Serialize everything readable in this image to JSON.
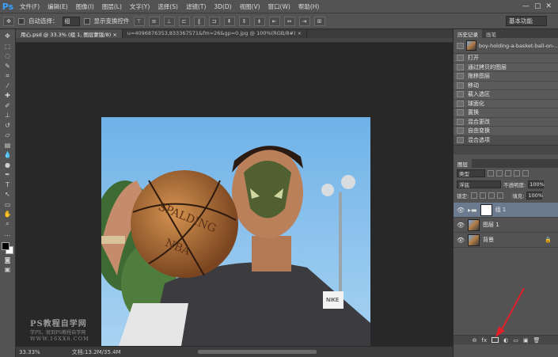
{
  "app": {
    "logo": "Ps"
  },
  "menu": [
    "文件(F)",
    "编辑(E)",
    "图像(I)",
    "图层(L)",
    "文字(Y)",
    "选择(S)",
    "滤镜(T)",
    "3D(D)",
    "视图(V)",
    "窗口(W)",
    "帮助(H)"
  ],
  "window_controls": [
    "—",
    "▢",
    "✕"
  ],
  "options": {
    "auto_select_label": "自动选择：",
    "auto_select_value": "组",
    "show_transform_label": "显示变换控件",
    "workspace": "基本功能"
  },
  "tabs": [
    {
      "label": "用心.psd @ 33.3% (组 1, 图层蒙版/8) × ",
      "active": true
    },
    {
      "label": "u=4096876353,833367571&fm=26&gp=0.jpg @ 100%(RGB/8#) ×",
      "active": false
    }
  ],
  "watermark": {
    "title": "PS教程自学网",
    "sub": "学PS，就到PS教程自学网",
    "url": "WWW.16XX8.COM"
  },
  "status": {
    "zoom": "33.33%",
    "doc": "文档:13.2M/35.4M"
  },
  "history": {
    "tabs": [
      "历史记录",
      "画笔"
    ],
    "snapshot": "boy-holding-a-basket-ball-on-...",
    "items": [
      "打开",
      "通过拷贝的图层",
      "拖移图层",
      "移动",
      "载入选区",
      "球面化",
      "置换",
      "混合更改",
      "自由变换",
      "混合选项"
    ]
  },
  "layers": {
    "tab": "图层",
    "filter_kind": "类型",
    "blend_mode": "浮底",
    "opacity_label": "不透明度:",
    "opacity": "100%",
    "lock_label": "锁定:",
    "fill_label": "填充:",
    "fill": "100%",
    "items": [
      {
        "name": "组 1",
        "type": "group",
        "selected": true
      },
      {
        "name": "图层 1",
        "type": "layer",
        "selected": false
      },
      {
        "name": "背景",
        "type": "background",
        "selected": false
      }
    ],
    "footer_icons": [
      "⊖",
      "fx",
      "◐",
      "▭",
      "▣",
      "🗑"
    ]
  },
  "colors": {
    "foreground": "#000000",
    "background": "#ffffff",
    "accent": "#3aa0ff",
    "arrow": "#e0202a"
  }
}
